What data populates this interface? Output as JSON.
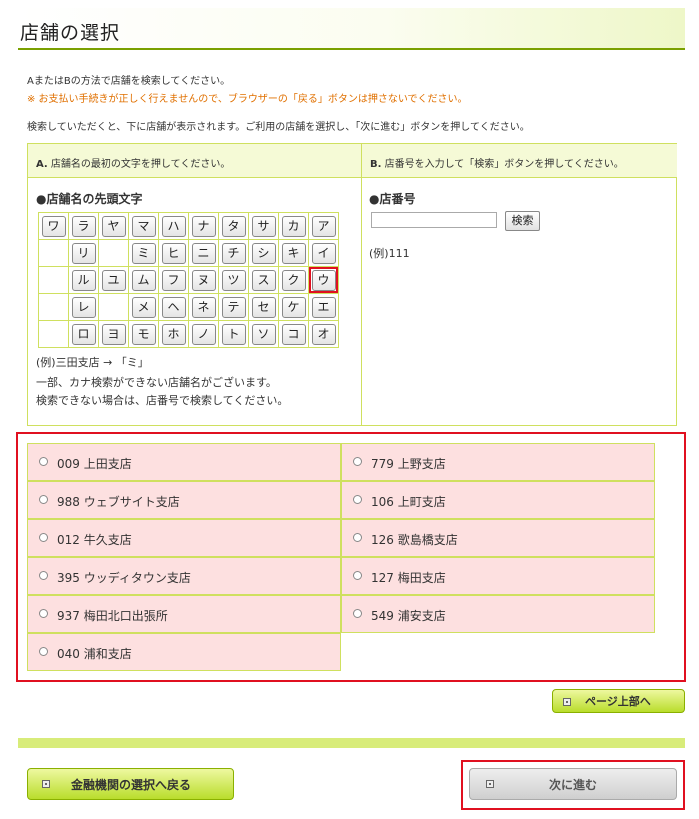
{
  "page": {
    "title": "店舗の選択"
  },
  "intro": {
    "line1": "AまたはBの方法で店舗を検索してください。",
    "warning": "※ お支払い手続きが正しく行えませんので、ブラウザーの「戻る」ボタンは押さないでください。",
    "line3": "検索していただくと、下に店舗が表示されます。ご利用の店舗を選択し、「次に進む」ボタンを押してください。"
  },
  "method_a": {
    "prefix": "A.",
    "header": "店舗名の最初の文字を押してください。",
    "subtitle": "●店舗名の先頭文字",
    "kana_rows": [
      [
        "ワ",
        "ラ",
        "ヤ",
        "マ",
        "ハ",
        "ナ",
        "タ",
        "サ",
        "カ",
        "ア"
      ],
      [
        "",
        "リ",
        "",
        "ミ",
        "ヒ",
        "ニ",
        "チ",
        "シ",
        "キ",
        "イ"
      ],
      [
        "",
        "ル",
        "ユ",
        "ム",
        "フ",
        "ヌ",
        "ツ",
        "ス",
        "ク",
        "ウ"
      ],
      [
        "",
        "レ",
        "",
        "メ",
        "ヘ",
        "ネ",
        "テ",
        "セ",
        "ケ",
        "エ"
      ],
      [
        "",
        "ロ",
        "ヨ",
        "モ",
        "ホ",
        "ノ",
        "ト",
        "ソ",
        "コ",
        "オ"
      ]
    ],
    "selected_kana": "ウ",
    "example": "(例)三田支店 → 「ミ」",
    "note1": "一部、カナ検索ができない店舗名がございます。",
    "note2": "検索できない場合は、店番号で検索してください。"
  },
  "method_b": {
    "prefix": "B.",
    "header": "店番号を入力して「検索」ボタンを押してください。",
    "subtitle": "●店番号",
    "input_value": "",
    "search_label": "検索",
    "example": "(例)111"
  },
  "results": [
    "009 上田支店",
    "779 上野支店",
    "988 ウェブサイト支店",
    "106 上町支店",
    "012 牛久支店",
    "126 歌島橋支店",
    "395 ウッディタウン支店",
    "127 梅田支店",
    "937 梅田北口出張所",
    "549 浦安支店",
    "040 浦和支店"
  ],
  "buttons": {
    "page_top": "ページ上部へ",
    "back": "金融機関の選択へ戻る",
    "next": "次に進む"
  },
  "colors": {
    "accent_green": "#b9dd2c",
    "result_bg": "#fde0e0",
    "highlight_red": "#e01020",
    "warning_orange": "#e07000"
  }
}
